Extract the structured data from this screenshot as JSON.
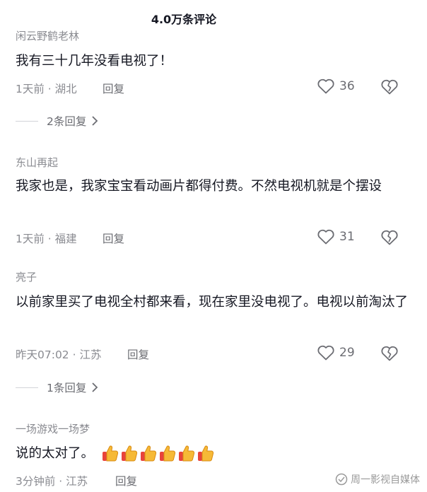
{
  "header": {
    "title": "4.0万条评论"
  },
  "comments": [
    {
      "username": "闲云野鹤老林",
      "content": "我有三十几年没看电视了！",
      "meta": "1天前 · 湖北",
      "reply_label": "回复",
      "likes": "36",
      "replies_label": "2条回复"
    },
    {
      "username": "东山再起",
      "content": "我家也是，我家宝宝看动画片都得付费。不然电视机就是个摆设",
      "meta": "1天前 · 福建",
      "reply_label": "回复",
      "likes": "31"
    },
    {
      "username": "亮子",
      "content": "以前家里买了电视全村都来看，现在家里没电视了。电视以前淘汰了",
      "meta": "昨天07:02 · 江苏",
      "reply_label": "回复",
      "likes": "29",
      "replies_label": "1条回复"
    },
    {
      "username": "一场游戏一场梦",
      "content": "说的太对了。",
      "meta": "3分钟前 · 江苏",
      "reply_label": "回复"
    }
  ],
  "watermark": {
    "text": "周一影视自媒体"
  },
  "icons": {
    "like": "heart-outline-icon",
    "dislike": "broken-heart-icon",
    "chevron": "chevron-right-icon",
    "emoji": "thumbs-up-emoji"
  },
  "colors": {
    "text": "#161823",
    "muted": "#8a8b91",
    "icon": "#6b6c72"
  }
}
